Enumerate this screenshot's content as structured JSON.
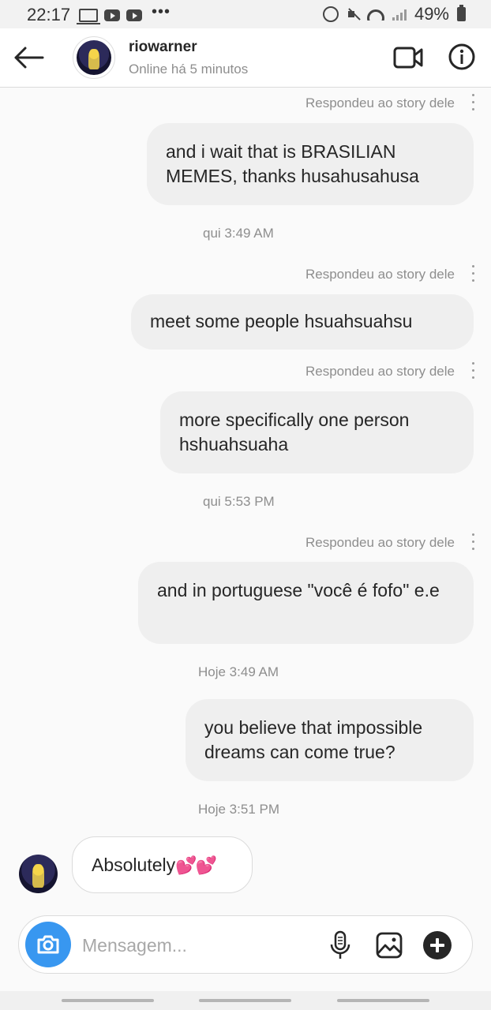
{
  "status_bar": {
    "time": "22:17",
    "battery": "49%"
  },
  "header": {
    "username": "riowarner",
    "presence": "Online há 5 minutos"
  },
  "thread": {
    "items": [
      {
        "kind": "story_reply_label",
        "text": "Respondeu ao story dele"
      },
      {
        "kind": "outgoing",
        "text": "and i wait that is BRASILIAN MEMES, thanks husahusahusa"
      },
      {
        "kind": "timestamp",
        "text": "qui 3:49 AM"
      },
      {
        "kind": "story_reply_label",
        "text": "Respondeu ao story dele"
      },
      {
        "kind": "outgoing",
        "text": "meet some people hsuahsuahsu"
      },
      {
        "kind": "story_reply_label",
        "text": "Respondeu ao story dele"
      },
      {
        "kind": "outgoing",
        "text": "more specifically one person hshuahsuaha"
      },
      {
        "kind": "timestamp",
        "text": "qui 5:53 PM"
      },
      {
        "kind": "story_reply_label",
        "text": "Respondeu ao story dele"
      },
      {
        "kind": "outgoing",
        "text": "and in portuguese \"você é fofo\" e.e"
      },
      {
        "kind": "timestamp",
        "text": "Hoje 3:49 AM"
      },
      {
        "kind": "outgoing",
        "text": "you believe that impossible dreams can come true?"
      },
      {
        "kind": "timestamp",
        "text": "Hoje 3:51 PM"
      },
      {
        "kind": "incoming",
        "text": "Absolutely",
        "emoji": "💕💕"
      }
    ]
  },
  "composer": {
    "placeholder": "Mensagem..."
  },
  "icons": {
    "back": "arrow-left-icon",
    "video": "video-camera-icon",
    "info": "info-icon",
    "camera": "camera-icon",
    "mic": "microphone-icon",
    "gallery": "image-icon",
    "add": "plus-icon"
  },
  "colors": {
    "accent": "#3897f0",
    "bubble": "#efefef",
    "secondary_text": "#8e8e8e"
  }
}
